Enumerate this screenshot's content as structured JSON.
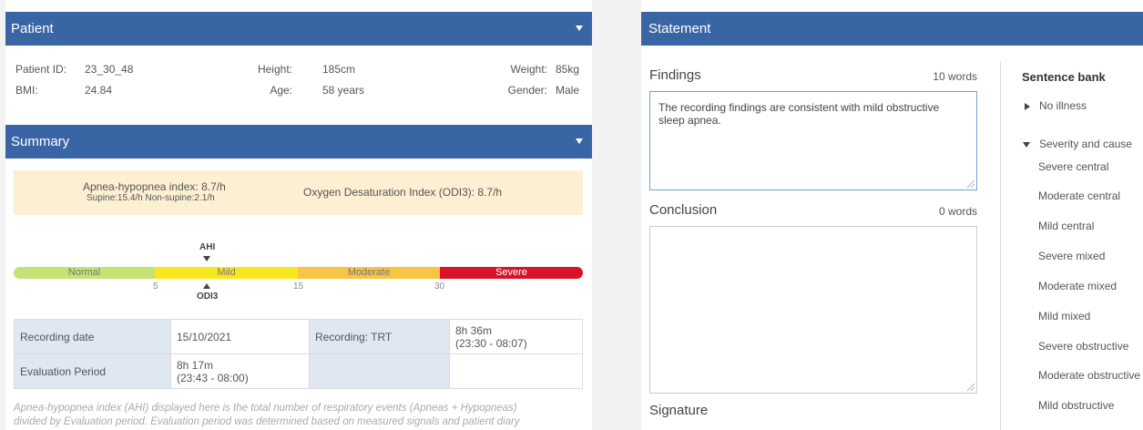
{
  "patient": {
    "header": "Patient",
    "id_label": "Patient ID:",
    "id_value": "23_30_48",
    "height_label": "Height:",
    "height_value": "185cm",
    "weight_label": "Weight:",
    "weight_value": "85kg",
    "bmi_label": "BMI:",
    "bmi_value": "24.84",
    "age_label": "Age:",
    "age_value": "58 years",
    "gender_label": "Gender:",
    "gender_value": "Male"
  },
  "summary": {
    "header": "Summary",
    "ahi_text": "Apnea-hypopnea index: 8.7/h",
    "ahi_sub": "Supine:15.4/h Non-supine:2.1/h",
    "odi_text": "Oxygen Desaturation Index (ODI3): 8.7/h",
    "ahi_marker": "AHI",
    "odi_marker": "ODI3",
    "ahi_value": 8.7,
    "odi_value": 8.7,
    "bands": [
      {
        "label": "Normal",
        "color": "#c5e274"
      },
      {
        "label": "Mild",
        "color": "#f8e71c"
      },
      {
        "label": "Moderate",
        "color": "#f7c544"
      },
      {
        "label": "Severe",
        "color": "#d7132a"
      }
    ],
    "ticks": [
      "5",
      "15",
      "30"
    ],
    "recording_date_label": "Recording date",
    "recording_date_value": "15/10/2021",
    "recording_trt_label": "Recording: TRT",
    "recording_trt_line1": "8h 36m",
    "recording_trt_line2": "(23:30 - 08:07)",
    "eval_label": "Evaluation Period",
    "eval_line1": "8h 17m",
    "eval_line2": "(23:43 - 08:00)",
    "note_line1": "Apnea-hypopnea index (AHI) displayed here is the total number of respiratory events (Apneas + Hypopneas)",
    "note_line2": "divided by Evaluation period. Evaluation period was determined based on measured signals and patient diary"
  },
  "statement": {
    "header": "Statement",
    "findings_label": "Findings",
    "findings_count": "10 words",
    "findings_text": "The recording findings are consistent with mild obstructive sleep apnea.",
    "conclusion_label": "Conclusion",
    "conclusion_count": "0 words",
    "conclusion_text": "",
    "signature_label": "Signature"
  },
  "sentence_bank": {
    "title": "Sentence bank",
    "groups": [
      {
        "label": "No illness",
        "expanded": false
      },
      {
        "label": "Severity and cause",
        "expanded": true
      }
    ],
    "items": [
      "Severe central",
      "Moderate central",
      "Mild central",
      "Severe mixed",
      "Moderate mixed",
      "Mild mixed",
      "Severe obstructive",
      "Moderate obstructive",
      "Mild obstructive"
    ]
  }
}
